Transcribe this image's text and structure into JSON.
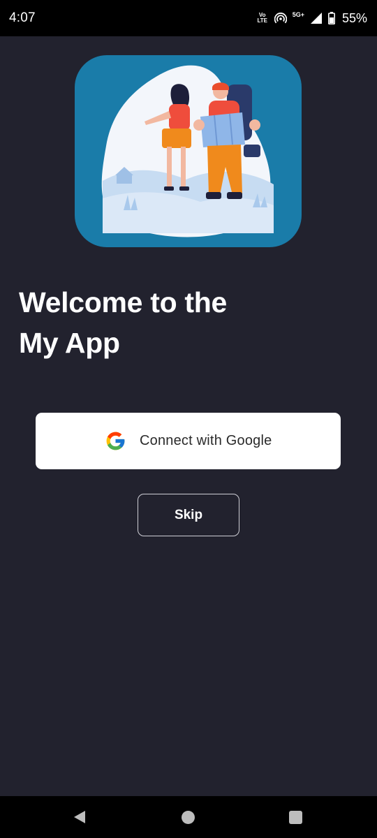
{
  "status_bar": {
    "time": "4:07",
    "volte_top": "Vo",
    "volte_bottom": "LTE",
    "network": "5G+",
    "battery": "55%"
  },
  "welcome": {
    "line1": "Welcome to the",
    "line2": "My App"
  },
  "buttons": {
    "google_label": "Connect with Google",
    "skip_label": "Skip"
  },
  "icons": {
    "status": [
      "volte-icon",
      "hotspot-icon",
      "signal-icon",
      "battery-icon"
    ],
    "google": "google-logo-icon",
    "nav": [
      "back-icon",
      "home-icon",
      "recents-icon"
    ]
  },
  "colors": {
    "background": "#22222e",
    "hero": "#1a7ca9",
    "button_bg": "#ffffff",
    "text": "#ffffff"
  }
}
